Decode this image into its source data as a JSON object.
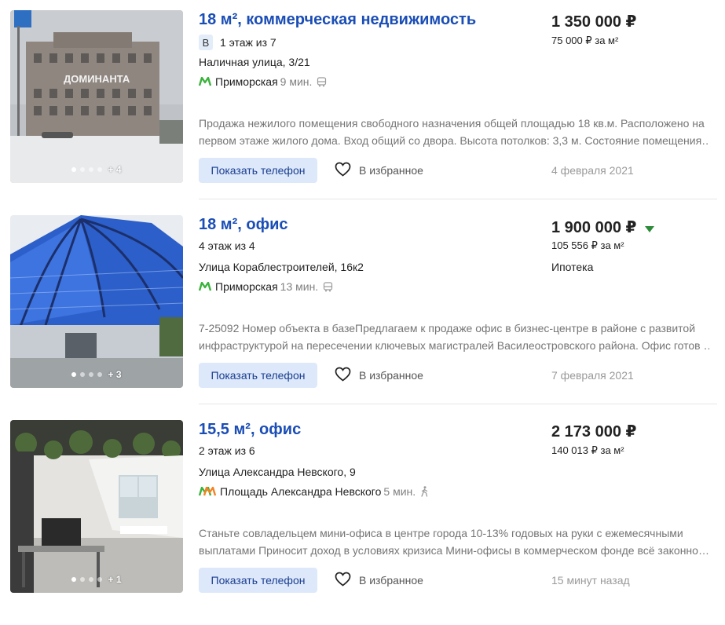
{
  "listings": [
    {
      "title": "18 м², коммерческая недвижимость",
      "class_badge": "B",
      "floor": "1 этаж из 7",
      "address": "Наличная улица, 3/21",
      "metro": {
        "station": "Приморская",
        "time": "9 мин.",
        "transport": "bus-icon",
        "line_colors": [
          "#3bb33b"
        ]
      },
      "description": [
        "Продажа нежилого помещения свободного назначения общей площадью 18 кв.м. Расположено на",
        "первом этаже жилого дома. Вход общий со двора. Высота потолков: 3,3 м. Состояние помещения…"
      ],
      "price": "1 350 000 ₽",
      "price_per_m2": "75 000 ₽ за м²",
      "photos_more": "+ 4",
      "date": "4 февраля 2021",
      "photo_label": "ДОМИНАНТА"
    },
    {
      "title": "18 м², офис",
      "floor": "4 этаж из 4",
      "address": "Улица Кораблестроителей, 16к2",
      "metro": {
        "station": "Приморская",
        "time": "13 мин.",
        "transport": "bus-icon",
        "line_colors": [
          "#3bb33b"
        ]
      },
      "description": [
        "7-25092 Номер объекта в базеПредлагаем к продаже офис в бизнес-центре в районе с развитой",
        "инфраструктурой на пересечении ключевых магистралей Василеостровского района. Офис готов …"
      ],
      "price": "1 900 000 ₽",
      "price_trend": "down",
      "price_per_m2": "105 556 ₽ за м²",
      "mortgage": "Ипотека",
      "photos_more": "+ 3",
      "date": "7 февраля 2021"
    },
    {
      "title": "15,5 м², офис",
      "floor": "2 этаж из 6",
      "address": "Улица Александра Невского, 9",
      "metro": {
        "station": "Площадь Александра Невского",
        "time": "5 мин.",
        "transport": "walk-icon",
        "line_colors": [
          "#3bb33b",
          "#f58220"
        ]
      },
      "description": [
        "Станьте совладельцем мини-офиса в центре города 10-13% годовых на руки с ежемесячными",
        "выплатами Приносит доход в условиях кризиса Мини-офисы в коммерческом фонде всё законно…"
      ],
      "price": "2 173 000 ₽",
      "price_per_m2": "140 013 ₽ за м²",
      "photos_more": "+ 1",
      "date": "15 минут назад"
    }
  ],
  "labels": {
    "show_phone": "Показать телефон",
    "favorite": "В избранное"
  },
  "colors": {
    "title_link": "#1a4db6",
    "phone_button_bg": "#dde9fb",
    "price_down": "#2e8b3a"
  }
}
